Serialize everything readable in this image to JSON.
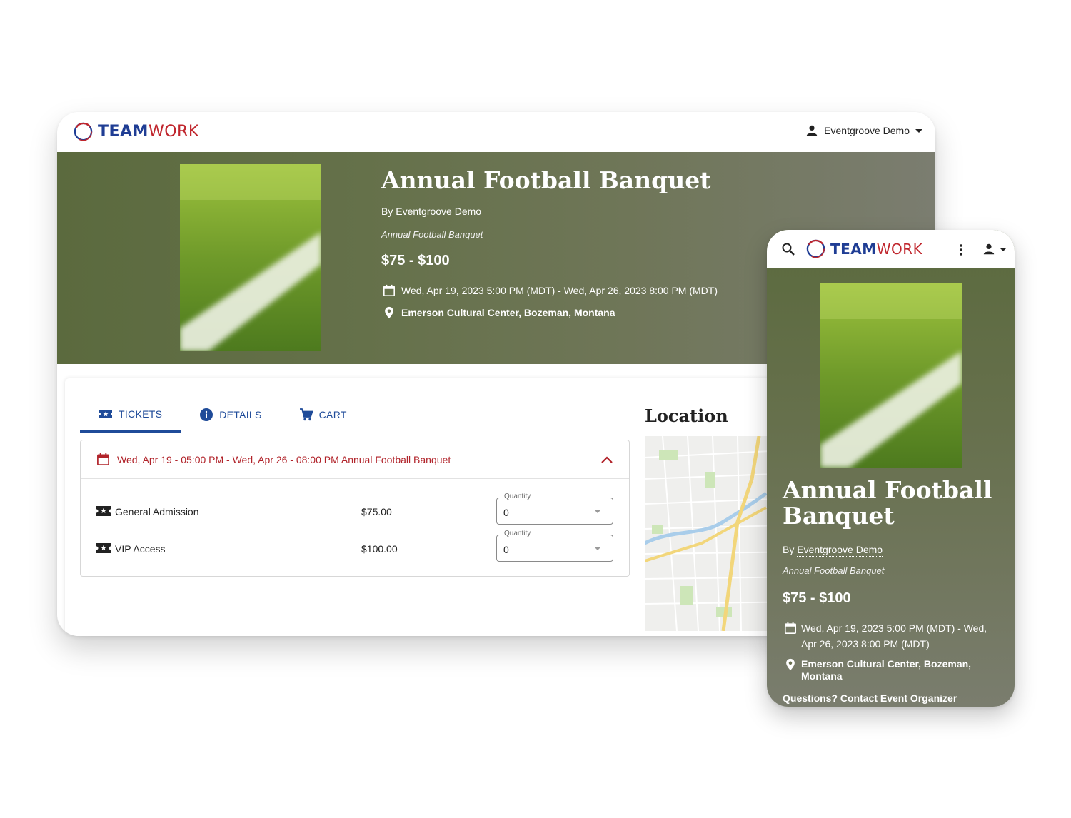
{
  "brand": {
    "team": "TEAM",
    "work": "WORK"
  },
  "colors": {
    "navy": "#1f3d94",
    "red": "#c0262d",
    "hero_green": "#5b6a3e",
    "link_blue": "#1f4b99",
    "event_red": "#b1232a"
  },
  "desktop": {
    "user": "Eventgroove Demo",
    "event": {
      "title": "Annual Football Banquet",
      "by_prefix": "By",
      "organizer": "Eventgroove Demo",
      "subtitle": "Annual Football Banquet",
      "price_range": "$75 - $100",
      "date_range": "Wed, Apr 19, 2023 5:00 PM (MDT) - Wed, Apr 26, 2023 8:00 PM (MDT)",
      "location": "Emerson Cultural Center, Bozeman, Montana"
    },
    "tabs": [
      {
        "label": "TICKETS",
        "icon": "ticket-icon"
      },
      {
        "label": "DETAILS",
        "icon": "info-icon"
      },
      {
        "label": "CART",
        "icon": "cart-icon"
      }
    ],
    "location_heading": "Location",
    "session": {
      "header": "Wed, Apr 19 - 05:00 PM - Wed, Apr 26 - 08:00 PM Annual Football Banquet",
      "tickets": [
        {
          "name": "General Admission",
          "price": "$75.00",
          "quantity_label": "Quantity",
          "quantity": "0"
        },
        {
          "name": "VIP Access",
          "price": "$100.00",
          "quantity_label": "Quantity",
          "quantity": "0"
        }
      ]
    }
  },
  "mobile": {
    "event": {
      "title": "Annual Football Banquet",
      "by_prefix": "By",
      "organizer": "Eventgroove Demo",
      "subtitle": "Annual Football Banquet",
      "price_range": "$75 - $100",
      "date_range": "Wed, Apr 19, 2023 5:00 PM (MDT) - Wed, Apr 26, 2023 8:00 PM (MDT)",
      "location": "Emerson Cultural Center, Bozeman, Montana"
    },
    "contact_link": "Questions? Contact Event Organizer"
  }
}
